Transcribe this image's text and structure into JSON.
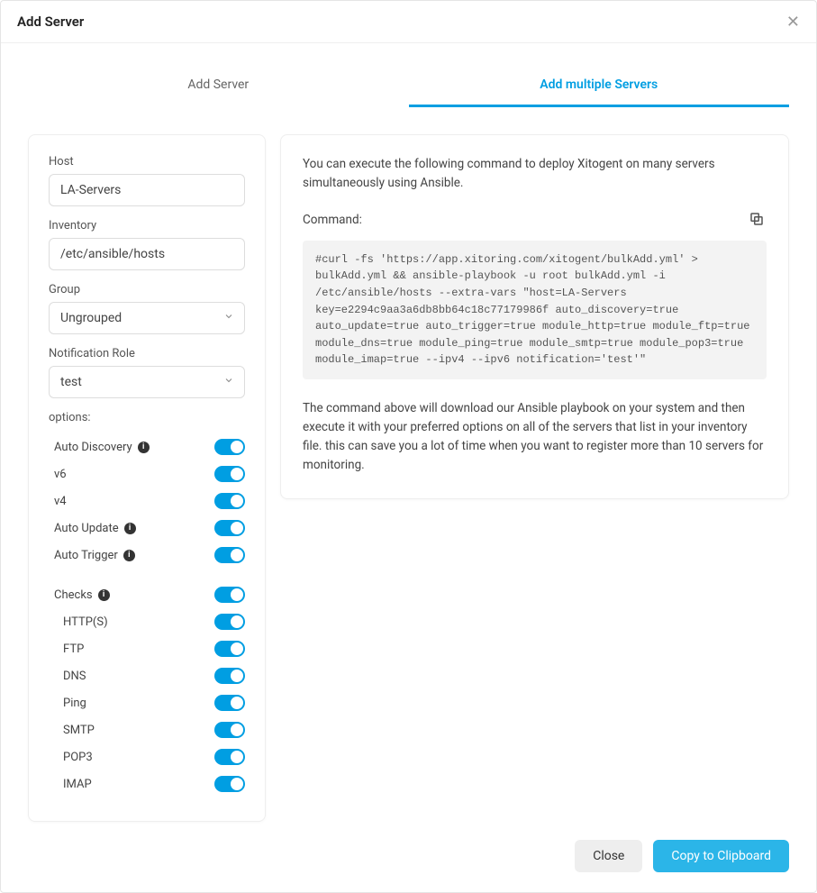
{
  "modal": {
    "title": "Add Server"
  },
  "tabs": {
    "add_server": "Add Server",
    "add_multiple": "Add multiple Servers"
  },
  "form": {
    "host_label": "Host",
    "host_value": "LA-Servers",
    "inventory_label": "Inventory",
    "inventory_value": "/etc/ansible/hosts",
    "group_label": "Group",
    "group_value": "Ungrouped",
    "notification_label": "Notification Role",
    "notification_value": "test",
    "options_label": "options:",
    "options": {
      "auto_discovery": "Auto Discovery",
      "v6": "v6",
      "v4": "v4",
      "auto_update": "Auto Update",
      "auto_trigger": "Auto Trigger"
    },
    "checks_label": "Checks",
    "checks": {
      "http": "HTTP(S)",
      "ftp": "FTP",
      "dns": "DNS",
      "ping": "Ping",
      "smtp": "SMTP",
      "pop3": "POP3",
      "imap": "IMAP"
    }
  },
  "right": {
    "intro": "You can execute the following command to deploy Xitogent on many servers simultaneously using Ansible.",
    "command_label": "Command:",
    "command": "#curl -fs 'https://app.xitoring.com/xitogent/bulkAdd.yml' > bulkAdd.yml && ansible-playbook -u root bulkAdd.yml -i /etc/ansible/hosts --extra-vars \"host=LA-Servers key=e2294c9aa3a6db8bb64c18c77179986f auto_discovery=true auto_update=true auto_trigger=true module_http=true module_ftp=true module_dns=true module_ping=true module_smtp=true module_pop3=true module_imap=true --ipv4 --ipv6 notification='test'\"",
    "explain": "The command above will download our Ansible playbook on your system and then execute it with your preferred options on all of the servers that list in your inventory file. this can save you a lot of time when you want to register more than 10 servers for monitoring."
  },
  "footer": {
    "close": "Close",
    "copy": "Copy to Clipboard"
  }
}
